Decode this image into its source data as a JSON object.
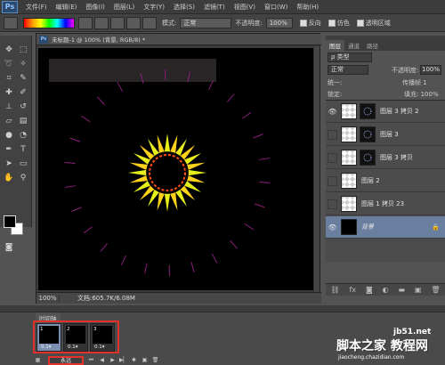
{
  "app": {
    "logo": "Ps",
    "menu": [
      "文件(F)",
      "编辑(E)",
      "图像(I)",
      "图层(L)",
      "文字(Y)",
      "选择(S)",
      "滤镜(T)",
      "视图(V)",
      "窗口(W)",
      "帮助(H)"
    ]
  },
  "options_bar": {
    "mode_label": "模式:",
    "mode_value": "正常",
    "opacity_label": "不透明度:",
    "opacity_value": "100%",
    "reverse_label": "反向",
    "dither_label": "仿色",
    "transparency_label": "透明区域"
  },
  "document": {
    "title": "未标题-1 @ 100% (背景, RGB/8) *",
    "zoom": "100%",
    "doc_size": "文档:605.7K/6.08M"
  },
  "layers_panel": {
    "tabs": [
      "图层",
      "通道",
      "路径"
    ],
    "kind_label": "ρ 类型",
    "blend_mode": "正常",
    "opacity_label": "不透明度:",
    "opacity_value": "100%",
    "unify_label": "统一:",
    "propagate_label": "传播帧 1",
    "lock_label": "锁定:",
    "fill_label": "填充: 100%",
    "layers": [
      {
        "name": "图层 3 拷贝 2",
        "visible": true,
        "has_mask": true
      },
      {
        "name": "图层 3",
        "visible": false,
        "has_mask": true
      },
      {
        "name": "图层 3 拷贝",
        "visible": false,
        "has_mask": true
      },
      {
        "name": "图层 2",
        "visible": false,
        "has_mask": false
      },
      {
        "name": "图层 1 拷贝 23",
        "visible": false,
        "has_mask": false
      },
      {
        "name": "背景",
        "visible": true,
        "has_mask": false,
        "selected": true,
        "locked": true
      }
    ]
  },
  "timeline": {
    "tab_label": "时间轴",
    "frames": [
      {
        "num": "1",
        "delay": "0.1▾"
      },
      {
        "num": "2",
        "delay": "0.1▾"
      },
      {
        "num": "3",
        "delay": "0.1▾"
      }
    ],
    "loop": "永远"
  },
  "watermark": {
    "site": "jb51.net",
    "text": "脚本之家 教程网",
    "domain": "jiaocheng.chazidian.com"
  },
  "colors": {
    "accent_red": "#e2312b",
    "selection_blue": "#6a7ea0"
  }
}
